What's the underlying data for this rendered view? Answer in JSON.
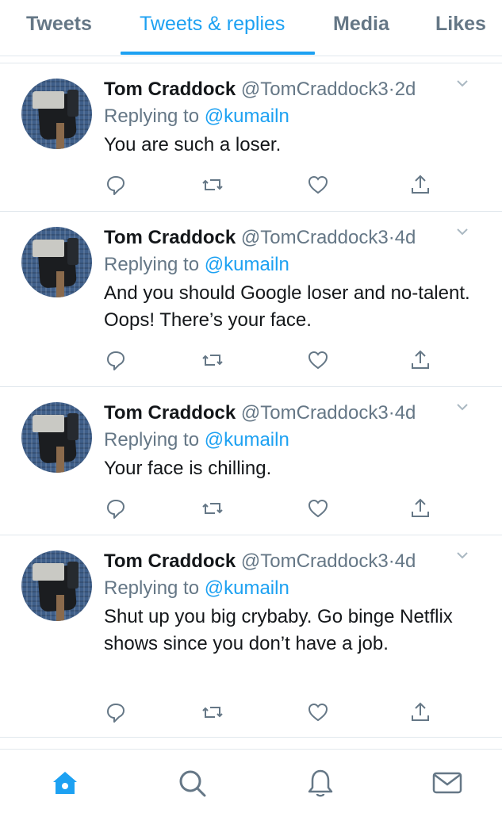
{
  "tabs": [
    {
      "label": "Tweets",
      "active": false
    },
    {
      "label": "Tweets & replies",
      "active": true
    },
    {
      "label": "Media",
      "active": false
    },
    {
      "label": "Likes",
      "active": false
    }
  ],
  "tweets": [
    {
      "name": "Tom Craddock",
      "handle": "@TomCraddock3",
      "dot": "·",
      "time": "2d",
      "replying_prefix": "Replying to",
      "replying_to": "@kumailn",
      "text": "You are such a loser."
    },
    {
      "name": "Tom Craddock",
      "handle": "@TomCraddock3",
      "dot": "·",
      "time": "4d",
      "replying_prefix": "Replying to",
      "replying_to": "@kumailn",
      "text": "And you should Google loser and no-talent. Oops! There’s your face."
    },
    {
      "name": "Tom Craddock",
      "handle": "@TomCraddock3",
      "dot": "·",
      "time": "4d",
      "replying_prefix": "Replying to",
      "replying_to": "@kumailn",
      "text": "Your face is chilling."
    },
    {
      "name": "Tom Craddock",
      "handle": "@TomCraddock3",
      "dot": "·",
      "time": "4d",
      "replying_prefix": "Replying to",
      "replying_to": "@kumailn",
      "text": "Shut up you big crybaby. Go binge Netflix shows since you don’t have a job."
    }
  ],
  "icons": {
    "caret": "chevron-down-icon",
    "reply": "reply-icon",
    "retweet": "retweet-icon",
    "like": "like-icon",
    "share": "share-icon",
    "home": "home-icon",
    "search": "search-icon",
    "notifications": "bell-icon",
    "messages": "mail-icon"
  },
  "colors": {
    "accent": "#1da1f2",
    "muted": "#657786",
    "divider": "#e1e8ed",
    "text": "#14171a"
  }
}
